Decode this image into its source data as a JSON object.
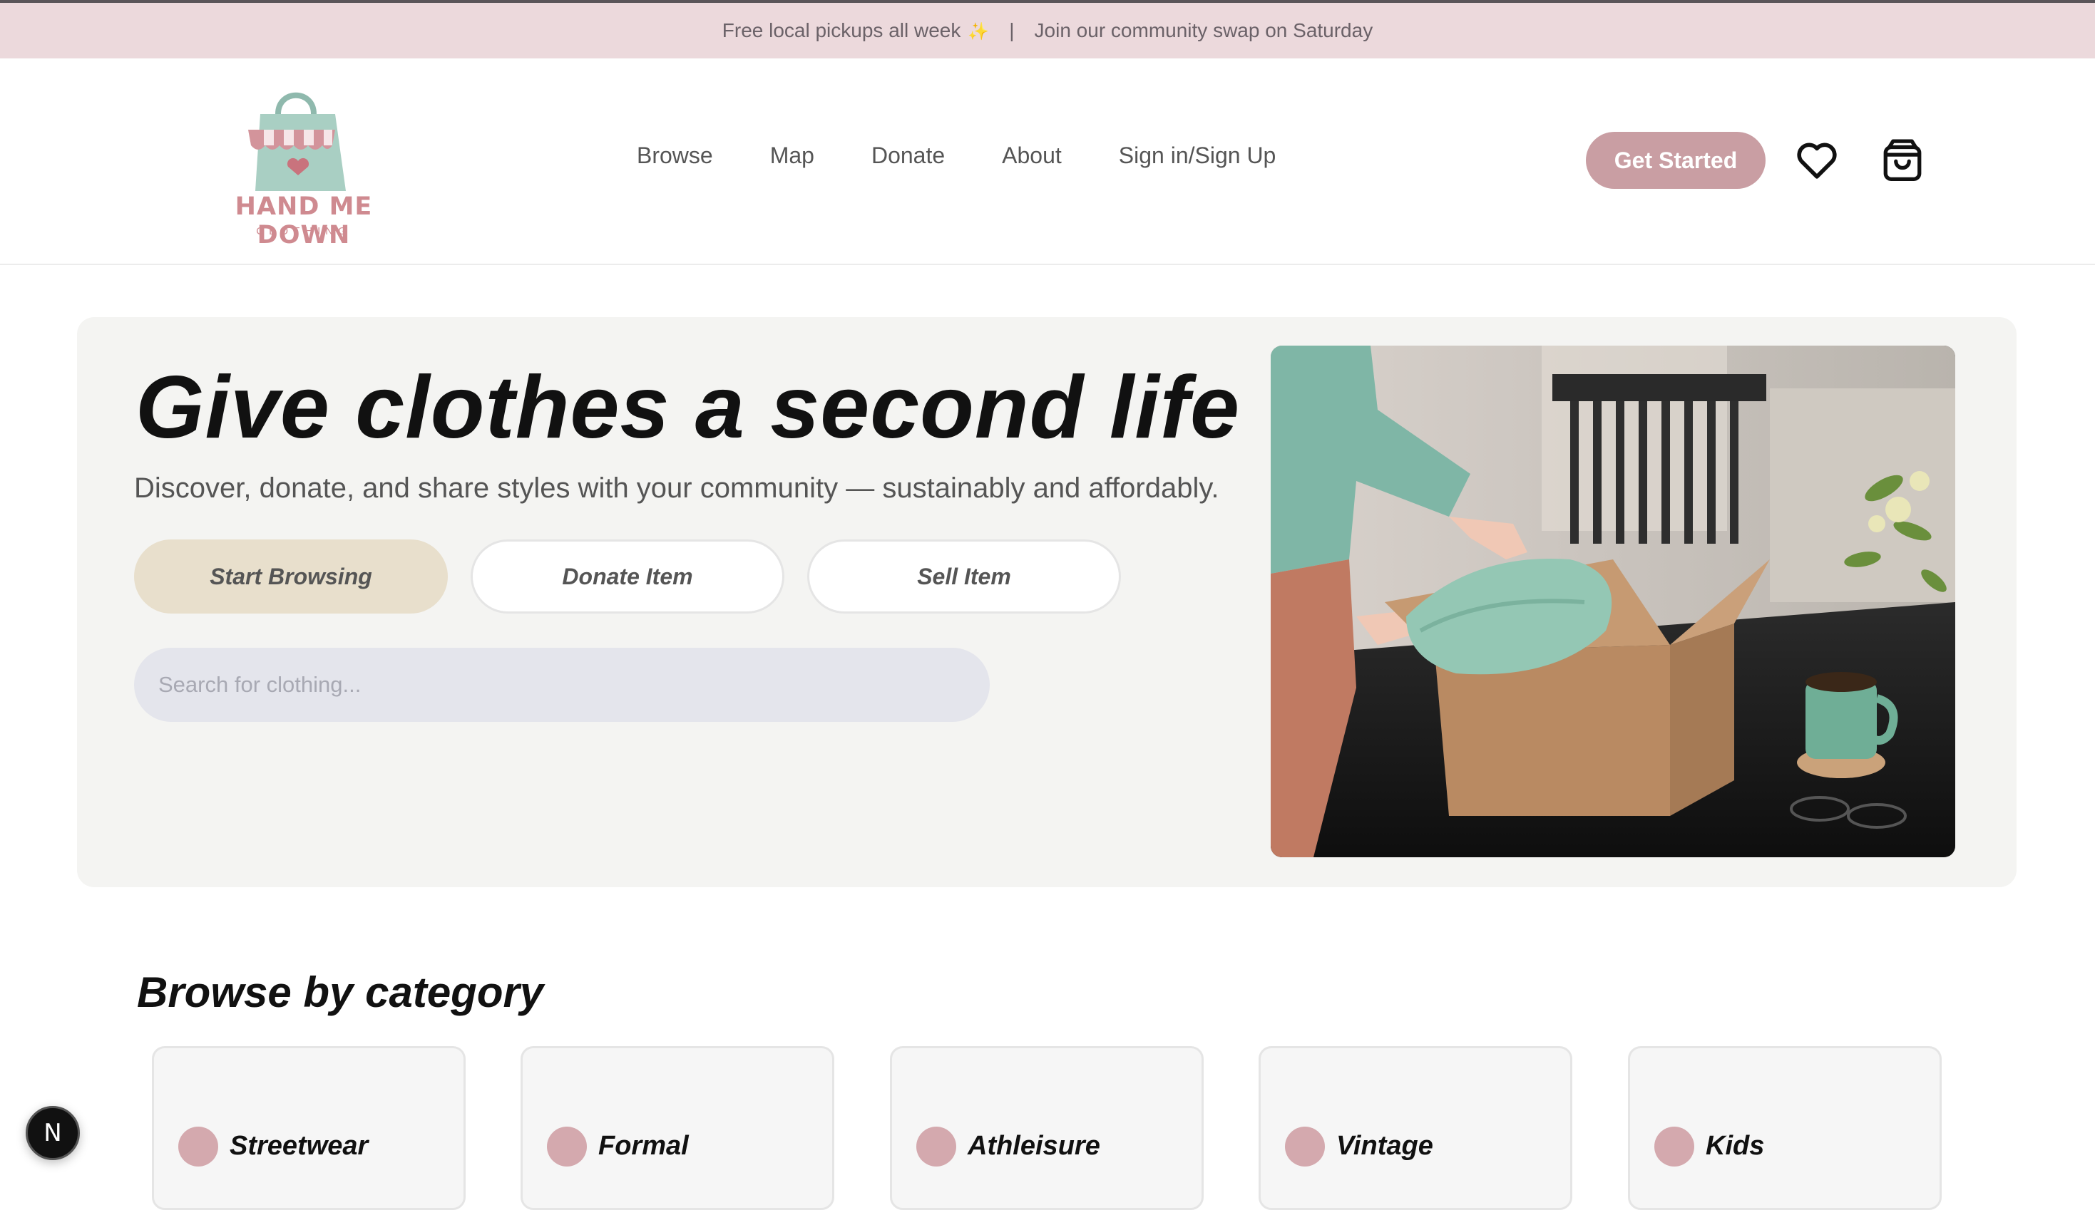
{
  "announcement": {
    "pickups": "Free local pickups all week",
    "separator": "|",
    "swap": "Join our community swap on Saturday"
  },
  "brand": {
    "name": "HAND ME DOWN",
    "tagline": "CLOTHING",
    "accent": "#c99ea3"
  },
  "nav": {
    "items": [
      {
        "label": "Browse"
      },
      {
        "label": "Map"
      },
      {
        "label": "Donate"
      },
      {
        "label": "About"
      },
      {
        "label": "Sign in/Sign Up"
      }
    ],
    "cta_label": "Get Started",
    "icons": [
      "heart-icon",
      "shopping-bag-icon"
    ]
  },
  "hero": {
    "title": "Give clothes a second life",
    "subtitle": "Discover, donate, and share styles with your community — sustainably and affordably.",
    "buttons": [
      {
        "label": "Start Browsing"
      },
      {
        "label": "Donate Item"
      },
      {
        "label": "Sell Item"
      }
    ],
    "search_placeholder": "Search for clothing..."
  },
  "categories": {
    "title": "Browse by category",
    "items": [
      {
        "label": "Streetwear"
      },
      {
        "label": "Formal"
      },
      {
        "label": "Athleisure"
      },
      {
        "label": "Vintage"
      },
      {
        "label": "Kids"
      }
    ]
  },
  "dev_badge": "N"
}
